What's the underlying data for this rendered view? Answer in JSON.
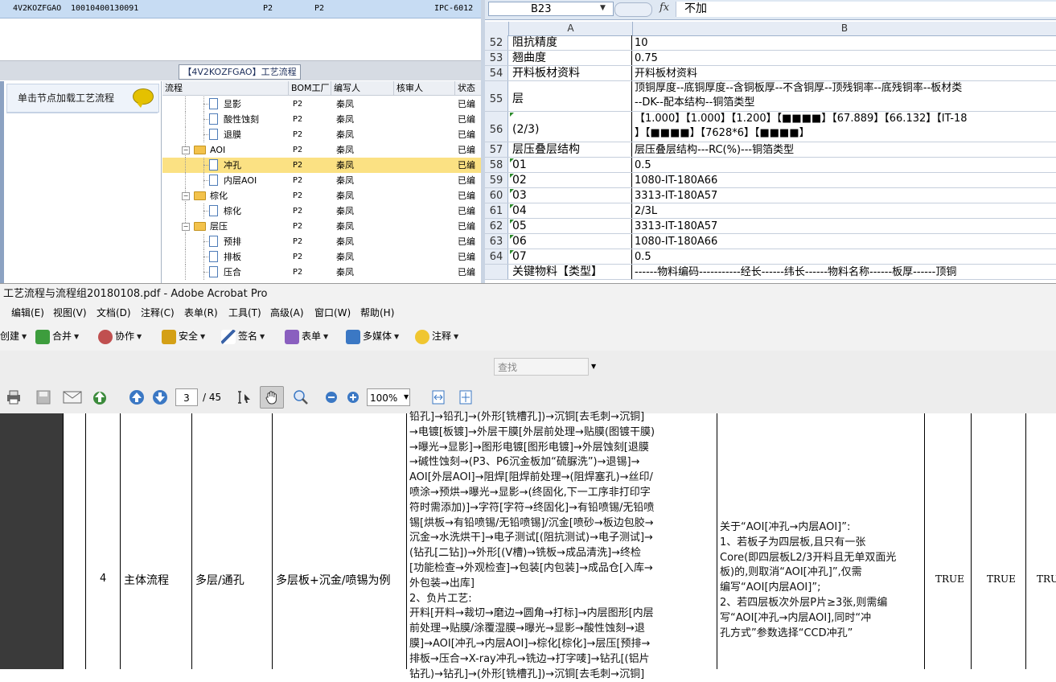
{
  "top_grid": {
    "row": {
      "col1": "4V2KOZFGAO",
      "col2": "10010400130091",
      "col3": "P2",
      "col4": "P2",
      "col5": "IPC-6012"
    }
  },
  "process_panel": {
    "title": "【4V2KOZFGAO】工艺流程",
    "load_button": "单击节点加载工艺流程",
    "columns": [
      "流程",
      "BOM工厂",
      "编写人",
      "核审人",
      "状态"
    ],
    "rows": [
      {
        "label": "显影",
        "kind": "doc",
        "indent": 2,
        "factory": "P2",
        "writer": "秦凤",
        "reviewer": "",
        "status": "已编"
      },
      {
        "label": "酸性蚀刻",
        "kind": "doc",
        "indent": 2,
        "factory": "P2",
        "writer": "秦凤",
        "reviewer": "",
        "status": "已编"
      },
      {
        "label": "退膜",
        "kind": "doc",
        "indent": 2,
        "factory": "P2",
        "writer": "秦凤",
        "reviewer": "",
        "status": "已编"
      },
      {
        "label": "AOI",
        "kind": "folder",
        "indent": 1,
        "factory": "P2",
        "writer": "秦凤",
        "reviewer": "",
        "status": "已编"
      },
      {
        "label": "冲孔",
        "kind": "doc",
        "indent": 2,
        "factory": "P2",
        "writer": "秦凤",
        "reviewer": "",
        "status": "已编",
        "selected": true
      },
      {
        "label": "内层AOI",
        "kind": "doc",
        "indent": 2,
        "factory": "P2",
        "writer": "秦凤",
        "reviewer": "",
        "status": "已编"
      },
      {
        "label": "棕化",
        "kind": "folder",
        "indent": 1,
        "factory": "P2",
        "writer": "秦凤",
        "reviewer": "",
        "status": "已编"
      },
      {
        "label": "棕化",
        "kind": "doc",
        "indent": 2,
        "factory": "P2",
        "writer": "秦凤",
        "reviewer": "",
        "status": "已编"
      },
      {
        "label": "层压",
        "kind": "folder",
        "indent": 1,
        "factory": "P2",
        "writer": "秦凤",
        "reviewer": "",
        "status": "已编"
      },
      {
        "label": "预排",
        "kind": "doc",
        "indent": 2,
        "factory": "P2",
        "writer": "秦凤",
        "reviewer": "",
        "status": "已编"
      },
      {
        "label": "排板",
        "kind": "doc",
        "indent": 2,
        "factory": "P2",
        "writer": "秦凤",
        "reviewer": "",
        "status": "已编"
      },
      {
        "label": "压合",
        "kind": "doc",
        "indent": 2,
        "factory": "P2",
        "writer": "秦凤",
        "reviewer": "",
        "status": "已编"
      }
    ]
  },
  "spreadsheet": {
    "name_box": "B23",
    "fx_label": "fx",
    "formula_value": "不加",
    "col_a": "A",
    "col_b": "B",
    "rows": [
      {
        "num": "52",
        "a": "阻抗精度",
        "b": [
          "10"
        ],
        "h": 19
      },
      {
        "num": "53",
        "a": "翘曲度",
        "b": [
          "0.75"
        ],
        "h": 19
      },
      {
        "num": "54",
        "a": "开料板材资料",
        "b": [
          "开料板材资料"
        ],
        "h": 19
      },
      {
        "num": "55",
        "a": "层",
        "b": [
          "顶铜厚度--底铜厚度--含铜板厚--不含铜厚--顶残铜率--底残铜率--板材类",
          "--DK--配本结构--铜箔类型"
        ],
        "h": 38
      },
      {
        "num": "56",
        "a": "(2/3)",
        "b": [
          "【1.000】【1.000】【1.200】【■■■■】【67.889】【66.132】【IT-18",
          "】【■■■■】【7628*6】【■■■■】"
        ],
        "h": 38
      },
      {
        "num": "57",
        "a": "层压叠层结构",
        "b": [
          "层压叠层结构---RC(%)---铜箔类型"
        ],
        "h": 19
      },
      {
        "num": "58",
        "a": "01",
        "b": [
          "0.5"
        ],
        "h": 19
      },
      {
        "num": "59",
        "a": "02",
        "b": [
          "1080-IT-180A66"
        ],
        "h": 19
      },
      {
        "num": "60",
        "a": "03",
        "b": [
          "3313-IT-180A57"
        ],
        "h": 19
      },
      {
        "num": "61",
        "a": "04",
        "b": [
          "2/3L"
        ],
        "h": 19
      },
      {
        "num": "62",
        "a": "05",
        "b": [
          "3313-IT-180A57"
        ],
        "h": 19
      },
      {
        "num": "63",
        "a": "06",
        "b": [
          "1080-IT-180A66"
        ],
        "h": 19
      },
      {
        "num": "64",
        "a": "07",
        "b": [
          "0.5"
        ],
        "h": 19
      },
      {
        "num": "",
        "a": "关键物料【类型】",
        "b": [
          "------物料编码-----------经长------纬长------物料名称------板厚------顶铜"
        ],
        "h": 19
      }
    ]
  },
  "acrobat": {
    "title": "工艺流程与流程组20180108.pdf - Adobe Acrobat Pro",
    "menu": [
      "编辑(E)",
      "视图(V)",
      "文档(D)",
      "注释(C)",
      "表单(R)",
      "工具(T)",
      "高级(A)",
      "窗口(W)",
      "帮助(H)"
    ],
    "toolbar": {
      "create": "创建",
      "combine": "合并",
      "collaborate": "协作",
      "secure": "安全",
      "sign": "签名",
      "forms": "表单",
      "multimedia": "多媒体",
      "comment": "注释"
    },
    "search_placeholder": "查找",
    "page_current": "3",
    "page_total": "/ 45",
    "zoom": "100%"
  },
  "document": {
    "index": "4",
    "category": "主体流程",
    "layer_type": "多层/通孔",
    "example": "多层板+沉金/喷锡为例",
    "flow_lines": [
      "铅孔]→铅孔]→(外形[铣槽孔])→沉铜[去毛刺→沉铜]",
      "→电镀[板镀]→外层干膜[外层前处理→贴膜(图镀干膜)",
      "→曝光→显影]→图形电镀[图形电镀]→外层蚀刻[退膜",
      "→碱性蚀刻→(P3、P6沉金板加“硫脲洗”)→退锡]→",
      "AOI[外层AOI]→阻焊[阻焊前处理→(阻焊塞孔)→丝印/",
      "喷涂→预烘→曝光→显影→(终固化,下一工序非打印字",
      "符时需添加)]→字符[字符→终固化]→有铅喷锡/无铅喷",
      "锡[烘板→有铅喷锡/无铅喷锡]/沉金[喷砂→板边包胶→",
      "沉金→水洗烘干]→电子测试[(阻抗测试)→电子测试]→",
      "(钻孔[二钻])→外形[(V槽)→铣板→成品清洗]→终检",
      "[功能检查→外观检查]→包装[内包装]→成品仓[入库→",
      "外包装→出库]",
      "2、负片工艺:",
      "开料[开料→裁切→磨边→圆角→打标]→内层图形[内层",
      "前处理→贴膜/涂覆湿膜→曝光→显影→酸性蚀刻→退",
      "膜]→AOI[冲孔→内层AOI]→棕化[棕化]→层压[预排→",
      "排板→压合→X-ray冲孔→铣边→打字唛]→钻孔[(铝片",
      "钻孔)→钻孔]→(外形[铣槽孔])→沉铜[去毛刺→沉铜]"
    ],
    "note_lines": [
      "关于“AOI[冲孔→内层AOI]”:",
      "1、若板子为四层板,且只有一张",
      "Core(即四层板L2/3开料且无单双面光",
      "板)的,则取消“AOI[冲孔]”,仅需",
      "编写“AOI[内层AOI]”;",
      "2、若四层板次外层P片≥3张,则需编",
      "写“AOI[冲孔→内层AOI],同时“冲",
      "孔方式”参数选择“CCD冲孔”"
    ],
    "flags": [
      "TRUE",
      "TRUE",
      "TRU"
    ]
  }
}
